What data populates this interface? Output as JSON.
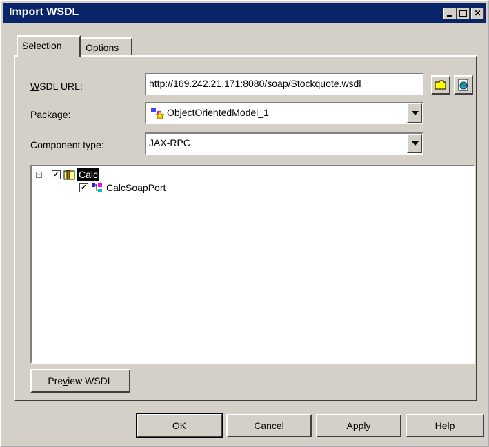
{
  "window": {
    "title": "Import WSDL",
    "controls": [
      "minimize",
      "maximize",
      "close"
    ]
  },
  "tabs": [
    {
      "label": "Selection",
      "active": true
    },
    {
      "label": "Options",
      "active": false
    }
  ],
  "form": {
    "wsdl_url_label_pre": "",
    "wsdl_url_label_u": "W",
    "wsdl_url_label_post": "SDL URL:",
    "wsdl_url_value": "http://169.242.21.171:8080/soap/Stockquote.wsdl",
    "package_label_pre": "Pac",
    "package_label_u": "k",
    "package_label_post": "age:",
    "package_value": "ObjectOrientedModel_1",
    "component_type_label": "Component type:",
    "component_type_value": "JAX-RPC"
  },
  "tree": {
    "root": {
      "label": "Calc",
      "checked": true,
      "expanded": true,
      "selected": true,
      "icon": "package-folder-icon"
    },
    "children": [
      {
        "label": "CalcSoapPort",
        "checked": true,
        "icon": "soap-port-icon"
      }
    ]
  },
  "buttons": {
    "preview_pre": "Pre",
    "preview_u": "v",
    "preview_post": "iew WSDL",
    "ok": "OK",
    "cancel": "Cancel",
    "apply_u": "A",
    "apply_post": "pply",
    "help": "Help"
  },
  "colors": {
    "titlebar": "#0a246a",
    "face": "#d4d0c8",
    "selection": "#000000"
  }
}
